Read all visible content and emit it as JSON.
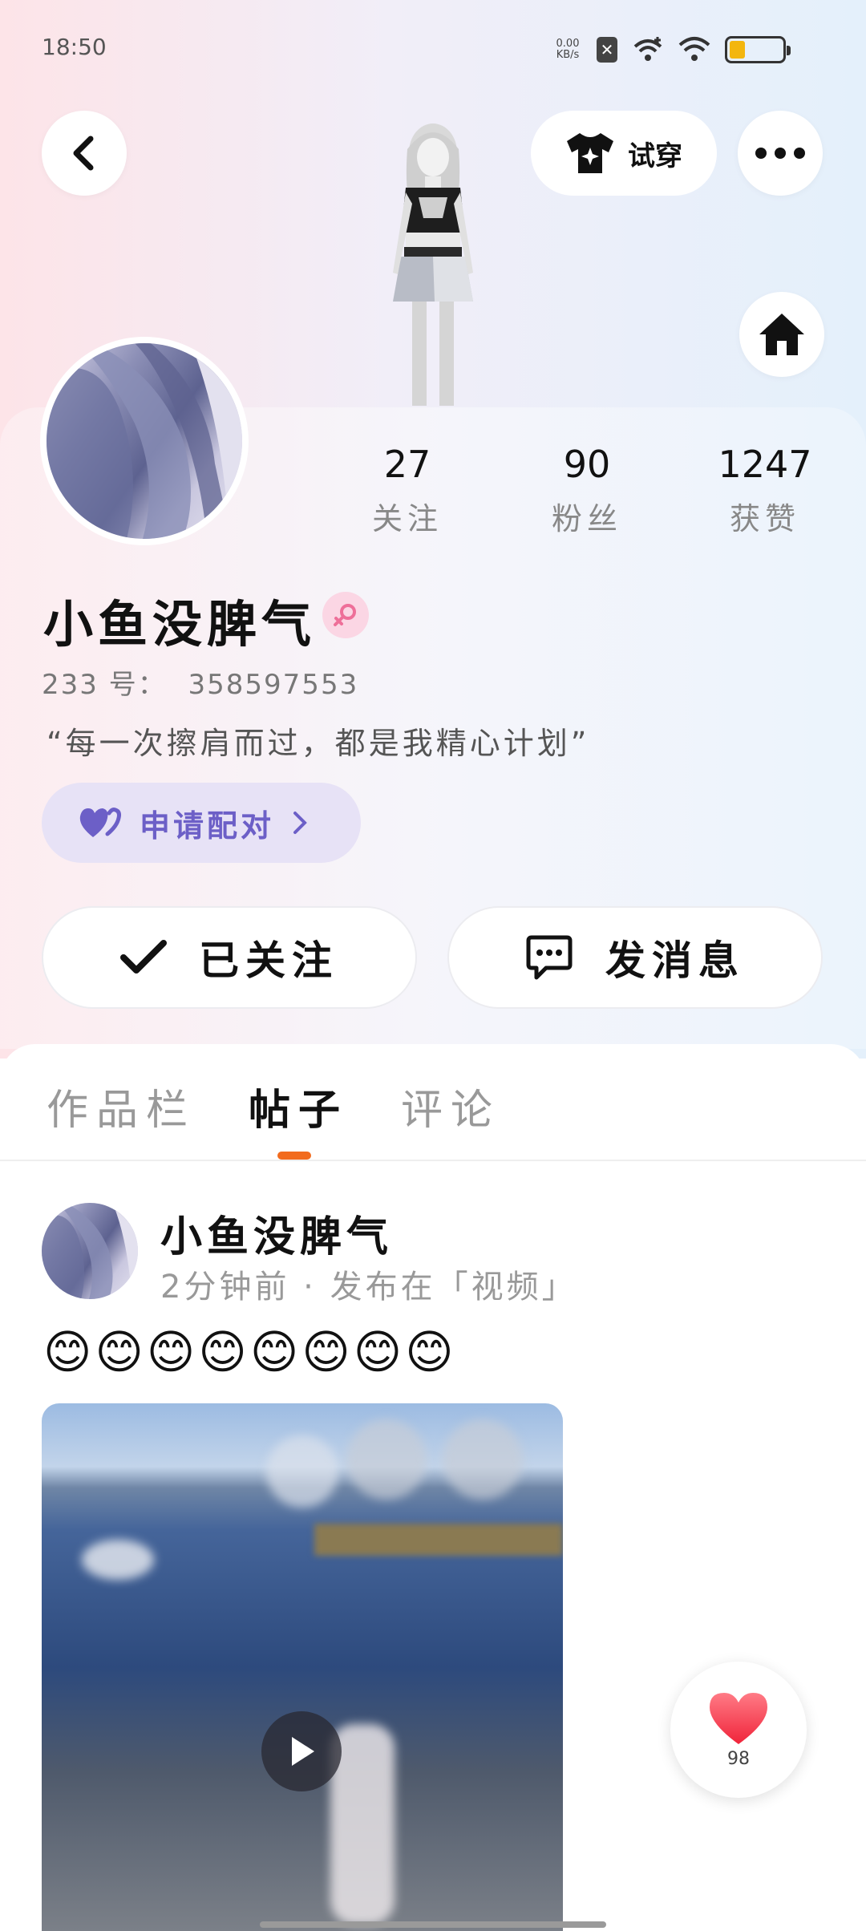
{
  "status_bar": {
    "time": "18:50",
    "net_speed_value": "0.00",
    "net_speed_unit": "KB/s",
    "battery_level": 0.3,
    "battery_color": "#f3b60e"
  },
  "header": {
    "tryon_label": "试穿",
    "back_icon": "chevron-left-icon",
    "more_icon": "more-horizontal-icon",
    "home_icon": "home-icon"
  },
  "profile": {
    "stats": [
      {
        "value": "27",
        "label": "关注"
      },
      {
        "value": "90",
        "label": "粉丝"
      },
      {
        "value": "1247",
        "label": "获赞"
      }
    ],
    "username": "小鱼没脾气",
    "gender_icon": "female-icon",
    "uid_label": "233 号：",
    "uid_value": "358597553",
    "bio": "“每一次擦肩而过，都是我精心计划”",
    "pair_label": "申请配对",
    "follow_label": "已关注",
    "message_label": "发消息"
  },
  "tabs": [
    {
      "label": "作品栏",
      "active": false
    },
    {
      "label": "帖子",
      "active": true
    },
    {
      "label": "评论",
      "active": false
    }
  ],
  "post": {
    "author": "小鱼没脾气",
    "meta": "2分钟前 · 发布在「视频」",
    "text": "😊😊😊😊😊😊😊😊",
    "like_count": "98"
  },
  "colors": {
    "accent_orange": "#f26b1d",
    "pair_purple": "#6c5fc7",
    "pair_bg": "#e7e2f6",
    "gender_pink": "#fbd6e4",
    "like_red": "#f43b4a"
  }
}
